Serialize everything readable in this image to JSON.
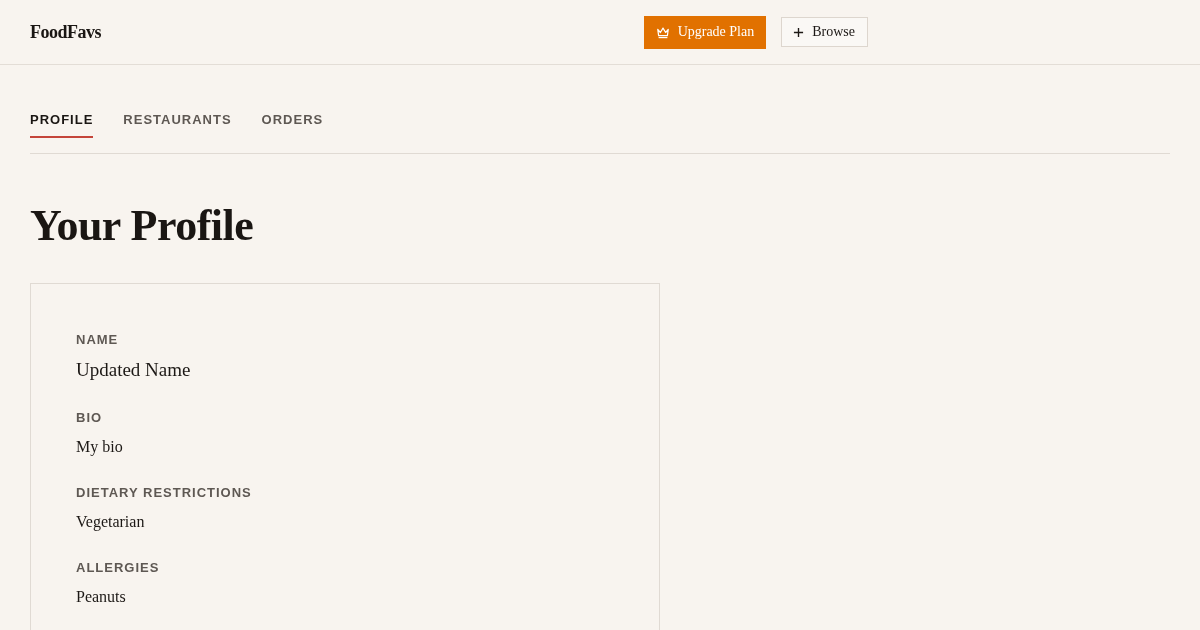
{
  "header": {
    "logo": "FoodFavs",
    "buttons": [
      {
        "label": "Upgrade Plan",
        "kind": "primary"
      },
      {
        "label": "Browse",
        "kind": "secondary"
      }
    ]
  },
  "tabs": [
    {
      "label": "PROFILE",
      "selected": true
    },
    {
      "label": "RESTAURANTS",
      "selected": false
    },
    {
      "label": "ORDERS",
      "selected": false
    }
  ],
  "page_title": "Your Profile",
  "profile_card": {
    "fields": [
      {
        "label": "NAME",
        "value": "Updated Name"
      },
      {
        "label": "BIO",
        "value": "My bio"
      },
      {
        "label": "DIETARY RESTRICTIONS",
        "value": "Vegetarian"
      },
      {
        "label": "ALLERGIES",
        "value": "Peanuts"
      }
    ]
  }
}
